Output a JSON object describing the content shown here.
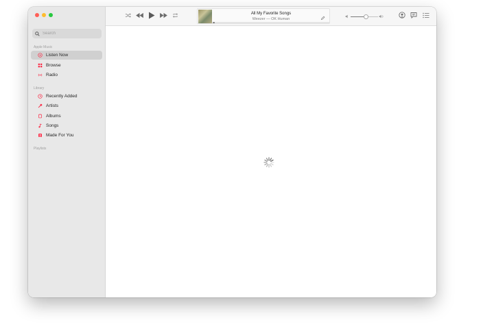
{
  "window": {
    "traffic_lights": {
      "close": "#ff5f57",
      "minimize": "#febc2e",
      "zoom": "#28c840"
    }
  },
  "sidebar": {
    "search": {
      "placeholder": "Search",
      "value": ""
    },
    "sections": [
      {
        "label": "Apple Music",
        "items": [
          {
            "label": "Listen Now",
            "icon": "play-circle-icon",
            "selected": true
          },
          {
            "label": "Browse",
            "icon": "grid-icon",
            "selected": false
          },
          {
            "label": "Radio",
            "icon": "radio-waves-icon",
            "selected": false
          }
        ]
      },
      {
        "label": "Library",
        "items": [
          {
            "label": "Recently Added",
            "icon": "clock-icon",
            "selected": false
          },
          {
            "label": "Artists",
            "icon": "microphone-icon",
            "selected": false
          },
          {
            "label": "Albums",
            "icon": "album-icon",
            "selected": false
          },
          {
            "label": "Songs",
            "icon": "music-note-icon",
            "selected": false
          },
          {
            "label": "Made For You",
            "icon": "person-square-icon",
            "selected": false
          }
        ]
      },
      {
        "label": "Playlists",
        "items": []
      }
    ],
    "accent_color": "#fa2d48"
  },
  "player": {
    "now_playing_title": "All My Favorite Songs",
    "now_playing_subtitle": "Weezer — OK Human",
    "progress": 0.02,
    "volume": 0.55,
    "controls": [
      "shuffle-icon",
      "previous-track-icon",
      "play-icon",
      "next-track-icon",
      "repeat-icon"
    ],
    "right_controls": [
      "airplay-icon",
      "lyrics-icon",
      "queue-list-icon"
    ]
  },
  "main": {
    "state": "loading"
  }
}
